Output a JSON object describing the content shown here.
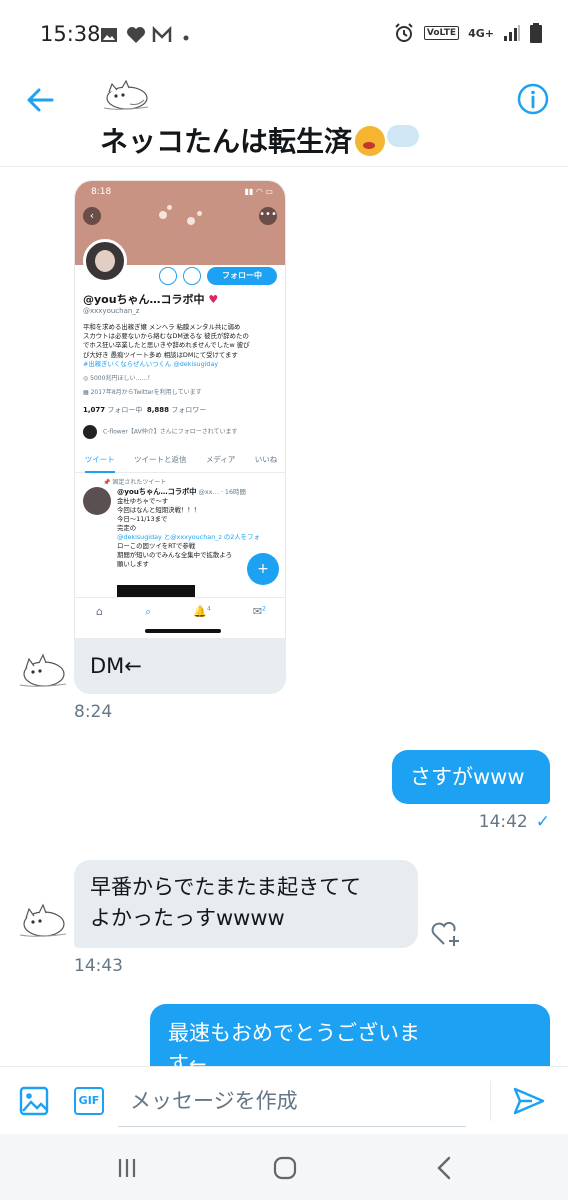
{
  "status_bar": {
    "time": "15:38",
    "network": "4G+",
    "volte": "VoLTE"
  },
  "header": {
    "title": "ネッコたんは転生済"
  },
  "shared_screenshot": {
    "time": "8:18",
    "follow_button": "フォロー中",
    "name": "@youちゃん…コラボ中",
    "handle": "@xxxyouchan_z",
    "bio_lines": [
      "平和を求める出稼ぎ嬢 メンヘラ 粘膜メンタル共に弱め",
      "スカウトは必要ないから絡むなDM送るな 彼氏が辞めたの",
      "でホス狂い卒業したと思いきや辞めれませんでしたw 彼ぴ",
      "ぴ大好き 愚痴ツイート多め 相談はDMにて受けてます"
    ],
    "bio_tags": "#出稼ぎいくならぜんいつくん @dekisugiday",
    "wish": "5000兆円ほしい……！",
    "joined": "2017年8月からTwitterを利用しています",
    "following_count": "1,077",
    "following_label": "フォロー中",
    "followers_count": "8,888",
    "followers_label": "フォロワー",
    "followed_by": "C-flower【AV仲介】さんにフォローされています",
    "tabs": [
      "ツイート",
      "ツイートと返信",
      "メディア",
      "いいね"
    ],
    "pinned_label": "固定されたツイート",
    "tweet_name": "@youちゃん…コラボ中",
    "tweet_handle_time": "@xx… · 16時間",
    "tweet_lines": [
      "金杜ゆちゃで〜す",
      "今回はなんと短期決戦！！！",
      "今日〜11/13まで",
      "完定の",
      "@dekisugiday と@xxxyouchan_z の2人をフォ",
      "ローこの固ツイをRTで参戦",
      "期間が短いのでみんな全集中で拡散よろ",
      "願いします"
    ],
    "notification_badge": "4",
    "dm_badge": "2"
  },
  "messages": [
    {
      "side": "in",
      "text": "DM←",
      "time": "8:24"
    },
    {
      "side": "out",
      "text": "さすがwww",
      "time": "14:42"
    },
    {
      "side": "in",
      "lines": [
        "早番からでたまたま起きてて",
        "よかったっすwwww"
      ],
      "time": "14:43"
    },
    {
      "side": "out",
      "lines": [
        "最速もおめでとうございま",
        "す←"
      ]
    }
  ],
  "composer": {
    "gif_label": "GIF",
    "placeholder": "メッセージを作成"
  },
  "colors": {
    "accent": "#1da1f2",
    "incoming_bubble": "#e6ecf0",
    "banner": "#c99384"
  },
  "icons": [
    "back-arrow-icon",
    "info-icon",
    "image-icon",
    "gif-icon",
    "send-icon",
    "heart-plus-icon",
    "recents-icon",
    "home-icon",
    "back-icon"
  ]
}
